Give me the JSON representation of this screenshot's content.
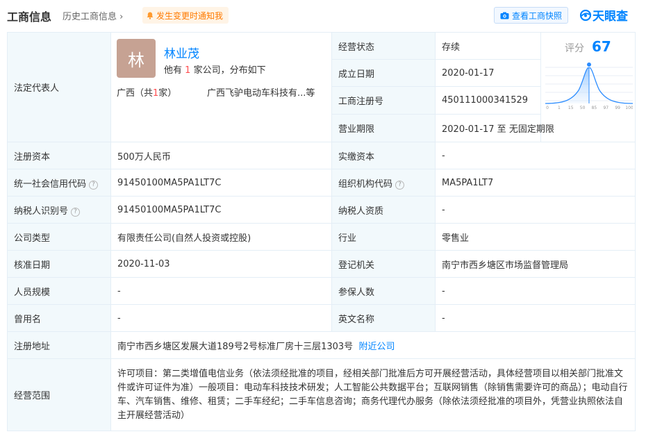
{
  "header": {
    "title": "工商信息",
    "history_label": "历史工商信息",
    "notify_label": "发生变更时通知我",
    "snapshot_label": "查看工商快照",
    "logo_text": "天眼查"
  },
  "legal_rep": {
    "label": "法定代表人",
    "avatar_char": "林",
    "name": "林业茂",
    "desc_prefix": "他有",
    "company_count": "1",
    "desc_suffix": "家公司，分布如下",
    "region_prefix": "广西（共",
    "region_count": "1",
    "region_suffix": "家）",
    "company": "广西飞驴电动车科技有...等"
  },
  "right_top": {
    "status_label": "经营状态",
    "status_value": "存续",
    "founded_label": "成立日期",
    "founded_value": "2020-01-17",
    "reg_no_label": "工商注册号",
    "reg_no_value": "450111000341529",
    "term_label": "营业期限",
    "term_value": "2020-01-17  至 无固定期限"
  },
  "score": {
    "label": "评分",
    "value": "67",
    "ticks": [
      "0",
      "1",
      "15",
      "50",
      "85",
      "97",
      "99",
      "100"
    ]
  },
  "rows": {
    "capital_label": "注册资本",
    "capital_value": "500万人民币",
    "paid_label": "实缴资本",
    "paid_value": "-",
    "credit_label": "统一社会信用代码",
    "credit_value": "91450100MA5PA1LT7C",
    "org_label": "组织机构代码",
    "org_value": "MA5PA1LT7",
    "tax_label": "纳税人识别号",
    "tax_value": "91450100MA5PA1LT7C",
    "taxpayer_label": "纳税人资质",
    "taxpayer_value": "-",
    "type_label": "公司类型",
    "type_value": "有限责任公司(自然人投资或控股)",
    "industry_label": "行业",
    "industry_value": "零售业",
    "approve_label": "核准日期",
    "approve_value": "2020-11-03",
    "authority_label": "登记机关",
    "authority_value": "南宁市西乡塘区市场监督管理局",
    "staff_label": "人员规模",
    "staff_value": "-",
    "insured_label": "参保人数",
    "insured_value": "-",
    "former_label": "曾用名",
    "former_value": "-",
    "english_label": "英文名称",
    "english_value": "-",
    "address_label": "注册地址",
    "address_value": "南宁市西乡塘区发展大道189号2号标准厂房十三层1303号",
    "nearby_label": "附近公司",
    "scope_label": "经营范围",
    "scope_value": "许可项目：第二类增值电信业务（依法须经批准的项目，经相关部门批准后方可开展经营活动，具体经营项目以相关部门批准文件或许可证件为准）一般项目：电动车科技技术研发；人工智能公共数据平台；互联网销售（除销售需要许可的商品）；电动自行车、汽车销售、维修、租赁；二手车经纪；二手车信息咨询；商务代理代办服务（除依法须经批准的项目外，凭营业执照依法自主开展经营活动）"
  },
  "icons": {
    "history_chevron": "chevron-right-icon",
    "notify": "bell-icon",
    "snapshot": "camera-icon",
    "help": "question-circle-icon",
    "logo": "tianyancha-logo-icon"
  },
  "colors": {
    "accent": "#0084ff",
    "warning": "#ff7a00",
    "label_bg": "#f2f9fc",
    "border": "#e4eef6",
    "avatar_bg": "#c6a293",
    "highlight": "#ff4d4f"
  }
}
